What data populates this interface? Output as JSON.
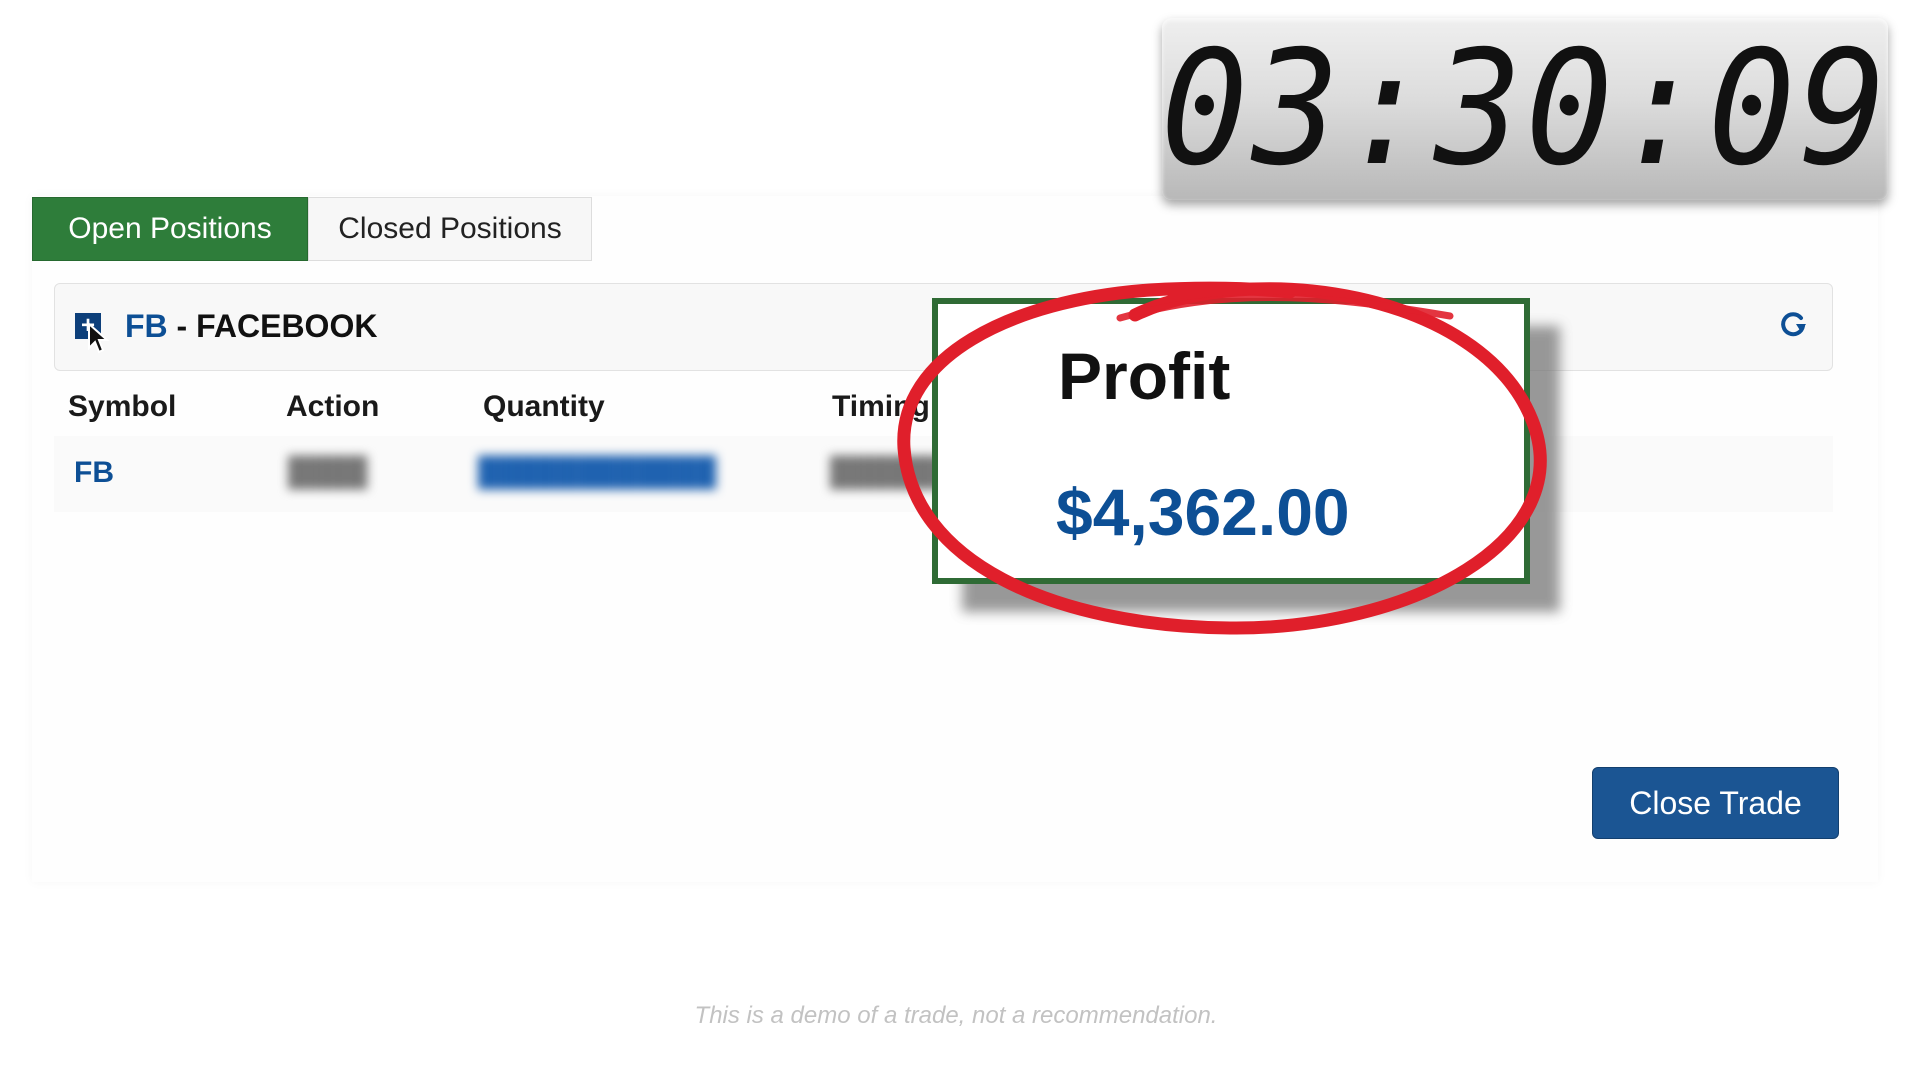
{
  "timer": {
    "display": "03:30:09"
  },
  "tabs": [
    {
      "label": "Open Positions",
      "active": true
    },
    {
      "label": "Closed Positions",
      "active": false
    }
  ],
  "position": {
    "symbol": "FB",
    "separator": " - ",
    "name": "FACEBOOK",
    "expand_icon": "plus-square-icon",
    "refresh_icon": "refresh-icon"
  },
  "table": {
    "headers": [
      "Symbol",
      "Action",
      "Quantity",
      "Timing"
    ],
    "rows": [
      {
        "symbol": "FB"
      }
    ]
  },
  "profit": {
    "label": "Profit",
    "value": "$4,362.00"
  },
  "buttons": {
    "close_trade": "Close Trade"
  },
  "footer": {
    "disclaimer": "This is a demo of a trade, not a recommendation."
  },
  "colors": {
    "tab_active": "#2e7d3a",
    "link_blue": "#0d4f95",
    "button_blue": "#1b5593",
    "highlight_red": "#e01f2b",
    "profit_border": "#2f6b35"
  }
}
